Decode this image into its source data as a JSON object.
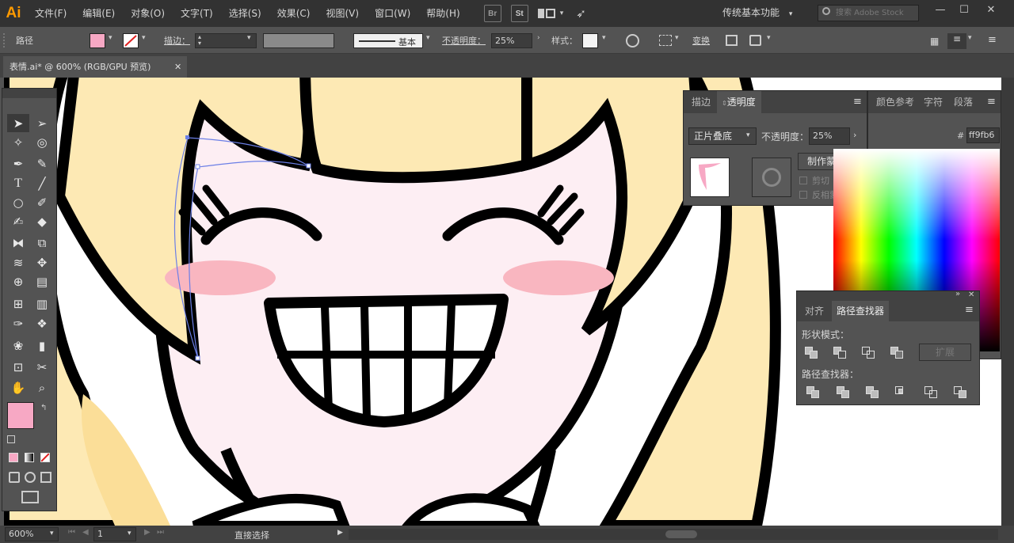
{
  "app": {
    "logo": "Ai"
  },
  "menu": [
    "文件(F)",
    "编辑(E)",
    "对象(O)",
    "文字(T)",
    "选择(S)",
    "效果(C)",
    "视图(V)",
    "窗口(W)",
    "帮助(H)"
  ],
  "menubar_icons": {
    "br": "Br",
    "st": "St"
  },
  "workspace_label": "传统基本功能",
  "stock_search_placeholder": "搜索 Adobe Stock",
  "control": {
    "selection_label": "路径",
    "stroke_label": "描边：",
    "stroke_profile": "基本",
    "opacity_label": "不透明度：",
    "opacity_value": "25%",
    "style_label": "样式：",
    "transform_label": "变换",
    "fill_color": "#f7a8c4"
  },
  "document_tab": "表情.ai* @ 600% (RGB/GPU 预览)",
  "status": {
    "zoom": "600%",
    "artboard": "1",
    "tool": "直接选择"
  },
  "transparency_panel": {
    "tabs": [
      "描边",
      "透明度"
    ],
    "active_tab": "透明度",
    "blend_mode": "正片叠底",
    "opacity_label": "不透明度：",
    "opacity_value": "25%",
    "make_mask": "制作蒙版",
    "clip_label": "剪切",
    "invert_mask_label": "反相蒙版"
  },
  "color_panel": {
    "tabs": [
      "颜色参考",
      "字符",
      "段落"
    ],
    "hex": "ff9fb6"
  },
  "pathfinder_panel": {
    "tabs": [
      "对齐",
      "路径查找器"
    ],
    "active_tab": "路径查找器",
    "shape_modes_label": "形状模式：",
    "expand_label": "扩展",
    "pathfinders_label": "路径查找器："
  },
  "colors": {
    "accent_fill": "#f7a8c4",
    "hair": "#fde9b4",
    "skin": "#fdeef3",
    "blush": "#f9b6c0"
  }
}
